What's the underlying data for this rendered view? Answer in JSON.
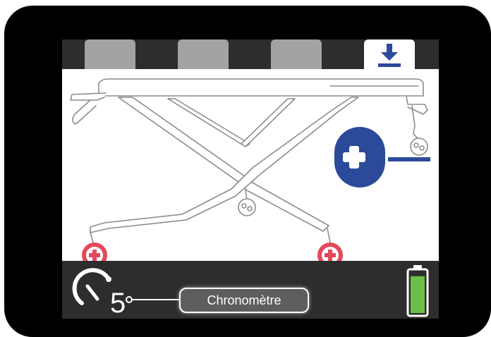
{
  "colors": {
    "accent_blue": "#2b4a9a",
    "wheel_red": "#e5485b",
    "battery_green": "#6cc04a",
    "panel_dark": "#2d2d2d",
    "tab_gray": "#a3a3a3"
  },
  "tabs": [
    {
      "icon": "blank",
      "active": false
    },
    {
      "icon": "blank",
      "active": false
    },
    {
      "icon": "blank",
      "active": false
    },
    {
      "icon": "download-icon",
      "active": true
    }
  ],
  "timer": {
    "icon": "stopwatch-icon",
    "value": "5"
  },
  "chrono_button": {
    "label": "Chronomètre"
  },
  "battery": {
    "icon": "battery-icon",
    "level": 0.9
  },
  "height_control": {
    "plus_icon": "plus-icon",
    "minus_icon": "minus-icon"
  }
}
